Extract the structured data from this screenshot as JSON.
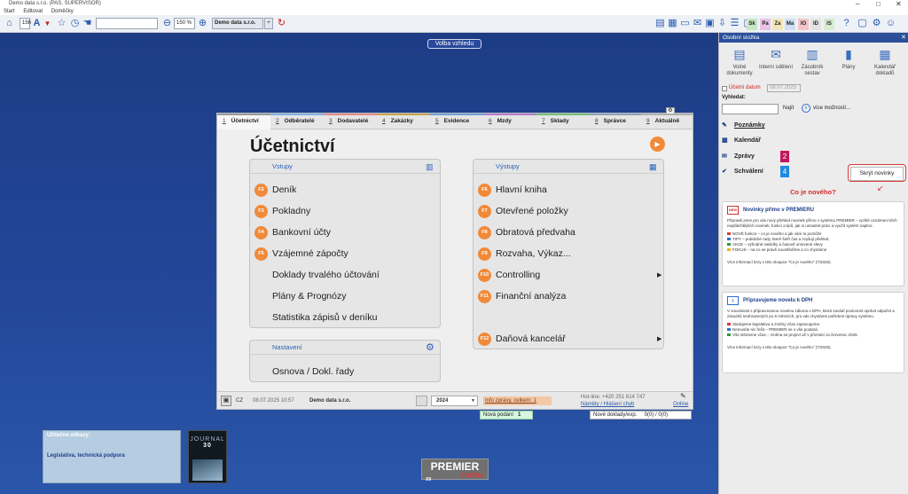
{
  "window": {
    "title": "Demo data s.r.o. (PAS, SUPERVISOR)"
  },
  "menu": [
    "Start",
    "Editovat",
    "Doměčky"
  ],
  "toolbar": {
    "record_value": "156",
    "zoom": "150 %",
    "company_tab": "Demo data s.r.o.",
    "add_tab": "+",
    "modules": [
      {
        "code": "Sk",
        "color": "#c7e6c2"
      },
      {
        "code": "Pa",
        "color": "#e9c2e6"
      },
      {
        "code": "Za",
        "color": "#f1e5b8"
      },
      {
        "code": "Ma",
        "color": "#cfe0f4"
      },
      {
        "code": "IO",
        "color": "#f2c6c6"
      },
      {
        "code": "ID",
        "color": "#e3e3e3"
      },
      {
        "code": "IS",
        "color": "#d5ecd0"
      }
    ]
  },
  "desktop": {
    "volba_vzhledu": "Volba vzhledu",
    "links_title": "Užitečné odkazy:",
    "links_item": "Legislativa, technická podpora",
    "journal_label": "JOURNAL",
    "journal_number": "30",
    "logo_main": "PREMIER",
    "logo_sub": "SYSTEM",
    "logo_version": "X9",
    "nova_podani_label": "Nová podání",
    "nova_podani_count": "1",
    "nove_doklady_label": "Nové doklady/exp.",
    "nove_doklady_value": "0(0) / 0(0)"
  },
  "main": {
    "tabs": [
      {
        "num": "1",
        "label": "Účetnictví",
        "color": "#9a9a9a"
      },
      {
        "num": "2",
        "label": "Odběratelé",
        "color": "#7fb3e0"
      },
      {
        "num": "3",
        "label": "Dodavatelé",
        "color": "#e08a8a"
      },
      {
        "num": "4",
        "label": "Zakázky",
        "color": "#c9a24a"
      },
      {
        "num": "5",
        "label": "Evidence",
        "color": "#6aa0d6"
      },
      {
        "num": "6",
        "label": "Mzdy",
        "color": "#b57ac9"
      },
      {
        "num": "7",
        "label": "Sklady",
        "color": "#6fbf73"
      },
      {
        "num": "8",
        "label": "Správce",
        "color": "#8fa0b8"
      },
      {
        "num": "9",
        "label": "Aktuálně",
        "color": "#b0b0b0"
      }
    ],
    "title": "Účetnictví",
    "vstupy": {
      "header": "Vstupy",
      "items": [
        {
          "key": "F2",
          "label": "Deník"
        },
        {
          "key": "F3",
          "label": "Pokladny"
        },
        {
          "key": "F4",
          "label": "Bankovní účty"
        },
        {
          "key": "F5",
          "label": "Vzájemné zápočty"
        },
        {
          "key": "",
          "label": "Doklady trvalého účtování"
        },
        {
          "key": "",
          "label": "Plány & Prognózy"
        },
        {
          "key": "",
          "label": "Statistika zápisů v deníku"
        }
      ]
    },
    "vystupy": {
      "header": "Výstupy",
      "items": [
        {
          "key": "F6",
          "label": "Hlavní kniha"
        },
        {
          "key": "F7",
          "label": "Otevřené položky"
        },
        {
          "key": "F8",
          "label": "Obratová předvaha"
        },
        {
          "key": "F9",
          "label": "Rozvaha, Výkaz..."
        },
        {
          "key": "F10",
          "label": "Controlling"
        },
        {
          "key": "F11",
          "label": "Finanční analýza"
        },
        {
          "key": "F12",
          "label": "Daňová kancelář"
        }
      ]
    },
    "nastaveni": {
      "header": "Nastavení",
      "items": [
        {
          "label": "Osnova / Dokl. řady"
        }
      ]
    },
    "status": {
      "lang": "CZ",
      "datetime": "08.07.2025  10:57",
      "company": "Demo data s.r.o.",
      "year": "2024",
      "info": "Info zprávy, celkem: 1",
      "hotline": "Hot-line: +420 251 614 747",
      "napady": "Náměty / Hlášení chyb",
      "online": "Online"
    }
  },
  "right": {
    "header": "Osobní složka",
    "buttons": [
      {
        "label": "Volné dokumenty",
        "icon": "calendar-doc"
      },
      {
        "label": "Interní sdělení",
        "icon": "envelope"
      },
      {
        "label": "Zásobník sestav",
        "icon": "stack"
      },
      {
        "label": "Plány",
        "icon": "chart"
      },
      {
        "label": "Kalendář dokladů",
        "icon": "calendar"
      }
    ],
    "ucetni_datum_label": "Účetní datum",
    "ucetni_datum_value": "08.07.2025",
    "vyhledat_label": "Vyhledat:",
    "najit": "Najít",
    "vice_moznosti": "více možností...",
    "poznamky": "Poznámky",
    "kalendar": "Kalendář",
    "zpravy": "Zprávy",
    "zpravy_count": "2",
    "schvaleni": "Schválení",
    "schvaleni_count": "4",
    "skryt_novinky": "Skrýt novinky",
    "co_je_noveho": "Co je nového?",
    "news": [
      {
        "icon_label": "NEW",
        "title": "Novinky přímo v PREMIERU",
        "intro": "Připravili jsme pro vás nový přehled novinek přímo v systému PREMIER – rychlé oznámení těch nejdůležitějších novinek, funkcí a tipů, jak si usnadnit práci a využít systém naplno.",
        "bullets": [
          {
            "text": "NOVÉ funkce – co je nového a jak vám to pomůže",
            "color": "#d93b3b"
          },
          {
            "text": "TIPY – praktické rady, které šetří čas a zvyšují přehled",
            "color": "#2b6fd0"
          },
          {
            "text": "AKCE – výhodné nabídky a časově omezené slevy",
            "color": "#2e9a3a"
          },
          {
            "text": "FOKUS – na co se právě soustředíme a co chystáme",
            "color": "#f0b020"
          }
        ],
        "more": "Více informací brzy v této sloupce \"Co je nového\" (7/2025)."
      },
      {
        "icon_label": "§",
        "title": "Připravujeme novelu k DPH",
        "intro": "V souvislosti s připravovanou novelou zákona o DPH, která zavádí povinnost oprávit odpočet a závazků neuhrazených po 6 měsících, pro vás chystáme potřebné úpravy systému.",
        "bullets": [
          {
            "text": "Sledujeme legislativu a změny včas zapracujeme.",
            "color": "#d93b3b"
          },
          {
            "text": "Nemusíte nic řešit – PREMIER se o vše postará.",
            "color": "#2b6fd0"
          },
          {
            "text": "Vše stihneme včas – změna se projeví až v přiznání za červenec 2025.",
            "color": "#2e9a3a"
          }
        ],
        "more": "Více informací brzy v této sloupce \"Co je nového\" (7/2025)."
      }
    ]
  }
}
